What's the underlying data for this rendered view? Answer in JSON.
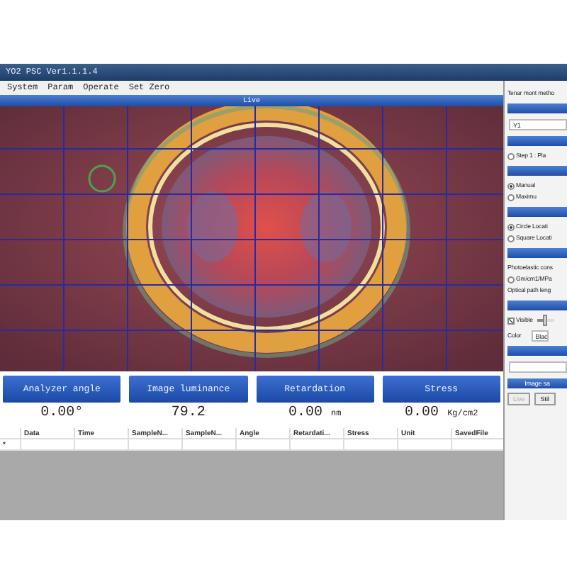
{
  "window": {
    "title": "YO2 PSC Ver1.1.1.4"
  },
  "menu": [
    "System",
    "Param",
    "Operate",
    "Set Zero"
  ],
  "live_header": "Live",
  "gauges": [
    {
      "label": "Analyzer angle",
      "value": "0.00°"
    },
    {
      "label": "Image luminance",
      "value": "79.2"
    },
    {
      "label": "Retardation",
      "value": "0.00",
      "unit": "nm"
    },
    {
      "label": "Stress",
      "value": "0.00",
      "unit": "Kg/cm2"
    }
  ],
  "table": {
    "columns": [
      "Data",
      "Time",
      "SampleN...",
      "SampleN...",
      "Angle",
      "Retardati...",
      "Stress",
      "Unit",
      "SavedFile"
    ],
    "new_row_marker": "*"
  },
  "side_panel": {
    "caption": "Tenar mont metho",
    "field_value": "Y1",
    "step_radio": {
      "label": "Step 1 : Pla",
      "checked": false
    },
    "mode_radios": [
      {
        "label": "Manual",
        "checked": true
      },
      {
        "label": "Maximu",
        "checked": false
      }
    ],
    "shape_radios": [
      {
        "label": "Circle  Locati",
        "checked": true
      },
      {
        "label": "Square  Locati",
        "checked": false
      }
    ],
    "constant_label": "Photoelastic cons",
    "unit_radio": {
      "label": "Gm/cm1/MPa",
      "checked": false
    },
    "path_label": "Optical path leng",
    "visible": {
      "label": "Visible",
      "checked": true,
      "level": 0.5
    },
    "color": {
      "label": "Color",
      "value": "Blac"
    },
    "image_header": "Image sa",
    "buttons": [
      {
        "label": "Live",
        "disabled": true
      },
      {
        "label": "Stil",
        "disabled": false
      }
    ]
  }
}
